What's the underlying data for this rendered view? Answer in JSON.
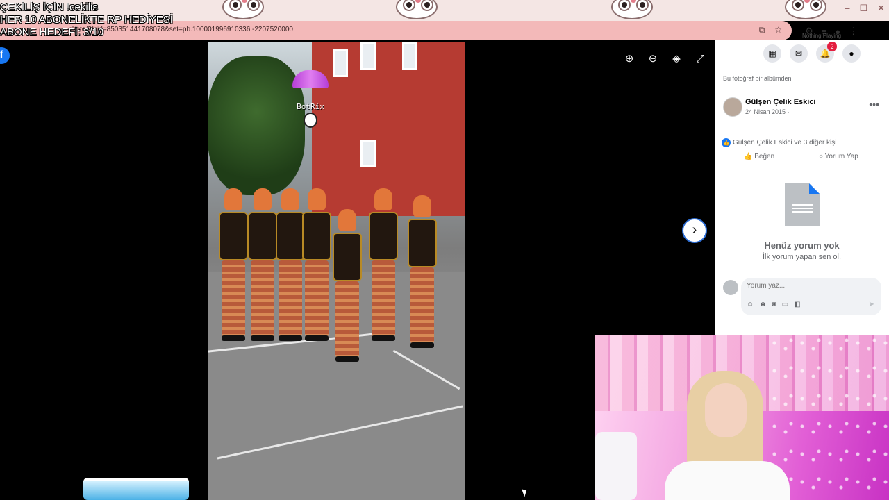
{
  "stream_overlay": {
    "giveaway": "ÇEKİLİŞ İÇİN !cekilis",
    "subgift": "HER 10 ABONELİKTE RP HEDİYESİ",
    "subgoal": "ABONE HEDEFİ: 3/10"
  },
  "browser": {
    "url": "...photo/?fbid=850351441708078&set=pb.100001996910336.-2207520000",
    "media_label": "Nothing Playing"
  },
  "viewer": {
    "botrix_label": "BotRix"
  },
  "fb_panel": {
    "notification_count": "2",
    "album_note": "Bu fotoğraf bir albümden",
    "author": "Gülşen Çelik Eskici",
    "date": "24 Nisan 2015 · ",
    "reactions": "Gülşen Çelik Eskici ve 3 diğer kişi",
    "like_label": "Beğen",
    "comment_label": "Yorum Yap",
    "no_comments_title": "Henüz yorum yok",
    "no_comments_sub": "İlk yorum yapan sen ol.",
    "comment_placeholder": "Yorum yaz..."
  }
}
